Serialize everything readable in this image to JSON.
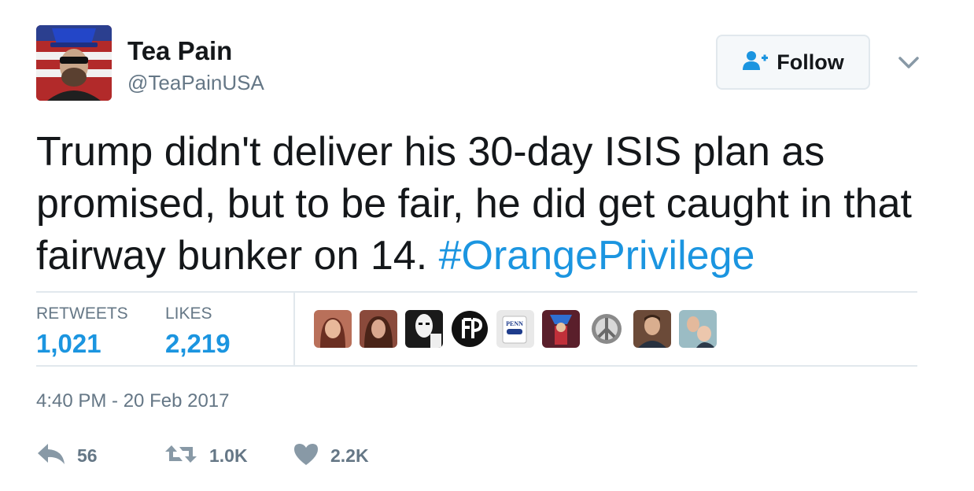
{
  "author": {
    "name": "Tea Pain",
    "handle": "@TeaPainUSA"
  },
  "follow_button": {
    "label": "Follow"
  },
  "tweet": {
    "text": "Trump didn't deliver his 30-day ISIS plan as promised, but to be fair, he did get caught in that fairway bunker on 14. ",
    "hashtag": "#OrangePrivilege"
  },
  "stats": {
    "retweets_label": "RETWEETS",
    "retweets_value": "1,021",
    "likes_label": "LIKES",
    "likes_value": "2,219"
  },
  "liker_avatars": [
    {
      "name": "liker-avatar-1",
      "color": "#b9705a"
    },
    {
      "name": "liker-avatar-2",
      "color": "#8a4a3b"
    },
    {
      "name": "liker-avatar-3",
      "color": "#1a1a1a"
    },
    {
      "name": "liker-avatar-4",
      "color": "#111111"
    },
    {
      "name": "liker-avatar-5",
      "color": "#e9e9e9"
    },
    {
      "name": "liker-avatar-6",
      "color": "#5a1f2b"
    },
    {
      "name": "liker-avatar-7",
      "color": "#d8d8d8"
    },
    {
      "name": "liker-avatar-8",
      "color": "#6b4a38"
    },
    {
      "name": "liker-avatar-9",
      "color": "#9bbcc4"
    }
  ],
  "timestamp": "4:40 PM - 20 Feb 2017",
  "actions": {
    "reply_count": "56",
    "retweet_count": "1.0K",
    "like_count": "2.2K"
  },
  "colors": {
    "link": "#1b95e0",
    "text": "#14171a",
    "muted": "#657786",
    "border": "#e1e8ed"
  }
}
